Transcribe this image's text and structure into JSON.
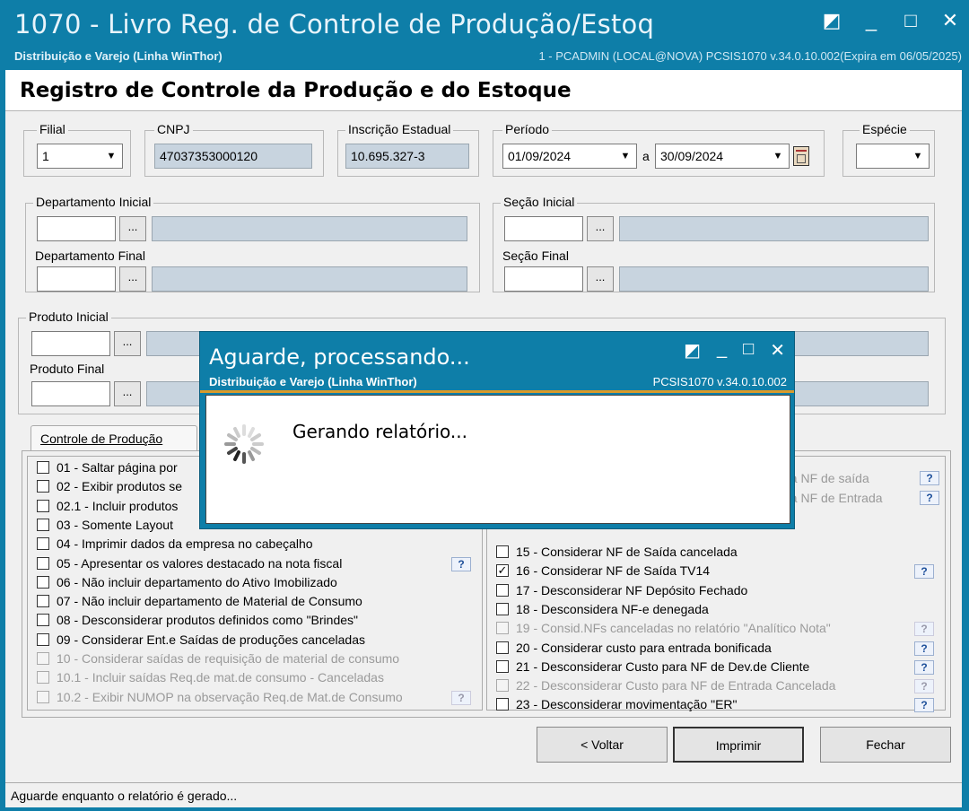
{
  "window": {
    "title": "1070 - Livro Reg. de Controle de Produção/Estoq",
    "subtitle": "Distribuição e Varejo (Linha WinThor)",
    "version": "1 - PCADMIN (LOCAL@NOVA)   PCSIS1070  v.34.0.10.002(Expira em 06/05/2025)",
    "restore_glyph": "◩",
    "minimize_glyph": "_",
    "maximize_glyph": "□",
    "close_glyph": "✕"
  },
  "form": {
    "heading": "Registro de Controle da Produção e do Estoque",
    "filial": {
      "label": "Filial",
      "value": "1"
    },
    "cnpj": {
      "label": "CNPJ",
      "value": "47037353000120"
    },
    "ie": {
      "label": "Inscrição Estadual",
      "value": "10.695.327-3"
    },
    "periodo": {
      "label": "Período",
      "start": "01/09/2024",
      "sep": "a",
      "end": "30/09/2024"
    },
    "especie": {
      "label": "Espécie",
      "value": ""
    },
    "dept_inicial": "Departamento Inicial",
    "dept_final": "Departamento Final",
    "secao_inicial": "Seção Inicial",
    "secao_final": "Seção Final",
    "produto_inicial": "Produto Inicial",
    "produto_final": "Produto Final",
    "ellipsis": "..."
  },
  "tabs": {
    "active": "Controle de Produção"
  },
  "left_options": [
    {
      "label": "01 - Saltar página por",
      "checked": false,
      "disabled": false
    },
    {
      "label": "02 - Exibir produtos se",
      "checked": false,
      "disabled": false
    },
    {
      "label": "02.1 - Incluir produtos",
      "checked": false,
      "disabled": false
    },
    {
      "label": "03 - Somente Layout",
      "checked": false,
      "disabled": false
    },
    {
      "label": "04 - Imprimir dados da empresa no cabeçalho",
      "checked": false,
      "disabled": false
    },
    {
      "label": "05 - Apresentar os valores destacado na nota fiscal",
      "checked": false,
      "disabled": false
    },
    {
      "label": "06 - Não incluir departamento do Ativo Imobilizado",
      "checked": false,
      "disabled": false
    },
    {
      "label": "07 - Não incluir departamento de Material de Consumo",
      "checked": false,
      "disabled": false
    },
    {
      "label": "08 - Desconsiderar produtos definidos como \"Brindes\"",
      "checked": false,
      "disabled": false
    },
    {
      "label": "09 - Considerar Ent.e Saídas de produções canceladas",
      "checked": false,
      "disabled": false
    },
    {
      "label": "10 - Considerar saídas de requisição de material de consumo",
      "checked": false,
      "disabled": true
    },
    {
      "label": "10.1 - Incluir saídas Req.de mat.de consumo - Canceladas",
      "checked": false,
      "disabled": true
    },
    {
      "label": "10.2 - Exibir NUMOP na observação Req.de Mat.de Consumo",
      "checked": false,
      "disabled": true
    }
  ],
  "right_partial": [
    "na NF de saída",
    "na NF de Entrada"
  ],
  "right_options": [
    {
      "label": "15 - Considerar NF de Saída cancelada",
      "checked": false,
      "disabled": false
    },
    {
      "label": "16 - Considerar NF de Saída TV14",
      "checked": true,
      "disabled": false
    },
    {
      "label": "17 - Desconsiderar NF Depósito Fechado",
      "checked": false,
      "disabled": false
    },
    {
      "label": "18 - Desconsidera NF-e denegada",
      "checked": false,
      "disabled": false
    },
    {
      "label": "19 - Consid.NFs canceladas no relatório \"Analítico Nota\"",
      "checked": false,
      "disabled": true
    },
    {
      "label": "20 - Considerar custo para entrada bonificada",
      "checked": false,
      "disabled": false
    },
    {
      "label": "21 - Desconsiderar Custo para NF de Dev.de Cliente",
      "checked": false,
      "disabled": false
    },
    {
      "label": "22 - Desconsiderar Custo para NF de Entrada Cancelada",
      "checked": false,
      "disabled": true
    },
    {
      "label": "23 - Desconsiderar movimentação \"ER\"",
      "checked": false,
      "disabled": false
    }
  ],
  "help_label": "?",
  "buttons": {
    "voltar": "< Voltar",
    "imprimir": "Imprimir",
    "fechar": "Fechar"
  },
  "status": "Aguarde enquanto o relatório é gerado...",
  "dialog": {
    "title": "Aguarde, processando...",
    "subtitle": "Distribuição e Varejo (Linha WinThor)",
    "version": "PCSIS1070  v.34.0.10.002",
    "message": "Gerando relatório..."
  }
}
